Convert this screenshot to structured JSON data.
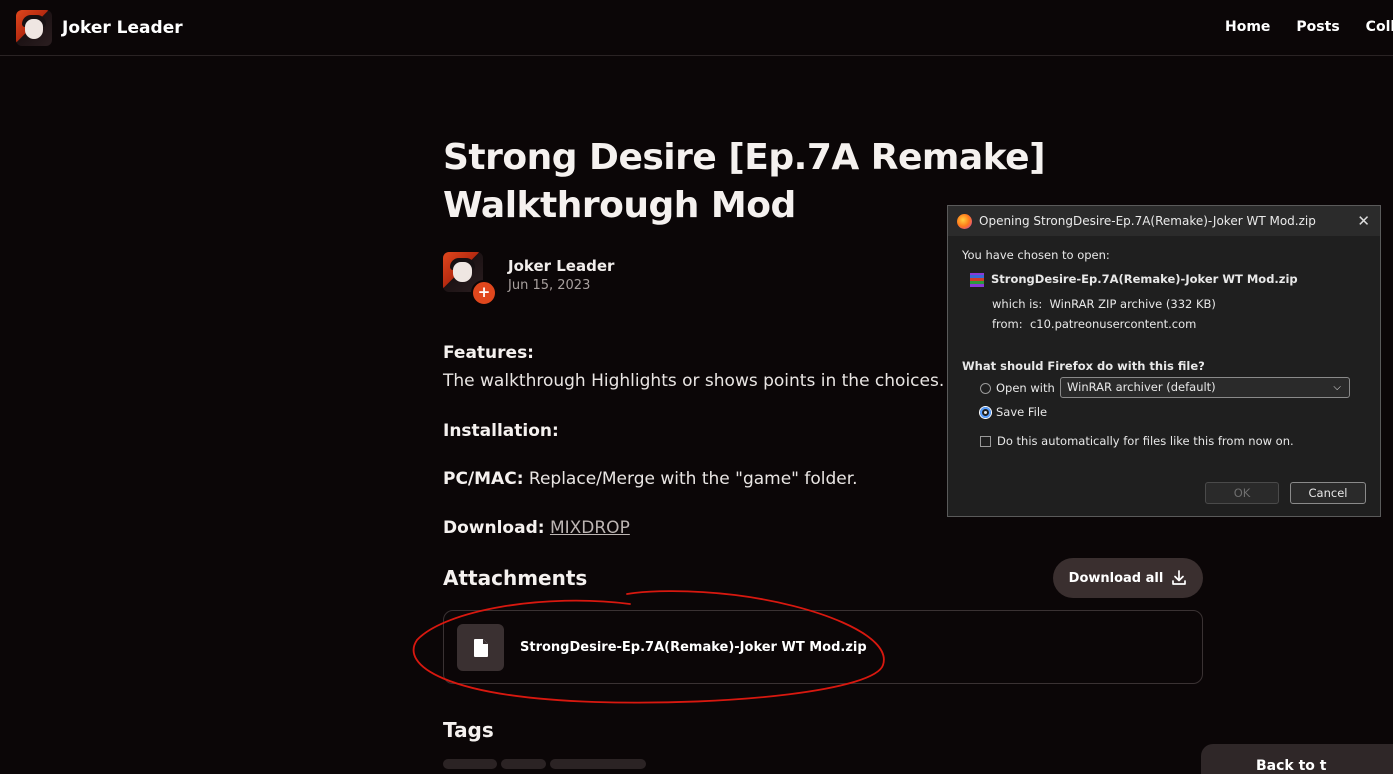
{
  "header": {
    "brand_name": "Joker Leader",
    "nav": [
      "Home",
      "Posts",
      "Collecti"
    ]
  },
  "post": {
    "title": "Strong Desire [Ep.7A Remake] Walkthrough Mod",
    "author_name": "Joker Leader",
    "author_date": "Jun 15, 2023",
    "avatar_plus": "+",
    "features_label": "Features:",
    "features_text": "The walkthrough Highlights or shows points in the choices.",
    "installation_label": "Installation:",
    "pc_label": "PC/MAC:",
    "pc_text": " Replace/Merge with the \"game\" folder.",
    "download_label": "Download:",
    "download_link": "MIXDROP",
    "attachments_heading": "Attachments",
    "download_all_label": "Download all",
    "file_name": "StrongDesire-Ep.7A(Remake)-Joker WT Mod.zip",
    "tags_heading": "Tags",
    "bottom_pill_text": "Back to t"
  },
  "dialog": {
    "title": "Opening StrongDesire-Ep.7A(Remake)-Joker WT Mod.zip",
    "chosen_label": "You have chosen to open:",
    "file_name": "StrongDesire-Ep.7A(Remake)-Joker WT Mod.zip",
    "which_is_label": "which is:",
    "which_is_value": "WinRAR ZIP archive (332 KB)",
    "from_label": "from:",
    "from_value": "c10.patreonusercontent.com",
    "question": "What should Firefox do with this file?",
    "open_with_label": "Open with",
    "open_with_value": "WinRAR archiver (default)",
    "save_file_label": "Save File",
    "auto_label": "Do this automatically for files like this from now on.",
    "ok_label": "OK",
    "cancel_label": "Cancel",
    "selected_option": "Save File"
  },
  "annotation": {
    "color": "#d8180f"
  }
}
